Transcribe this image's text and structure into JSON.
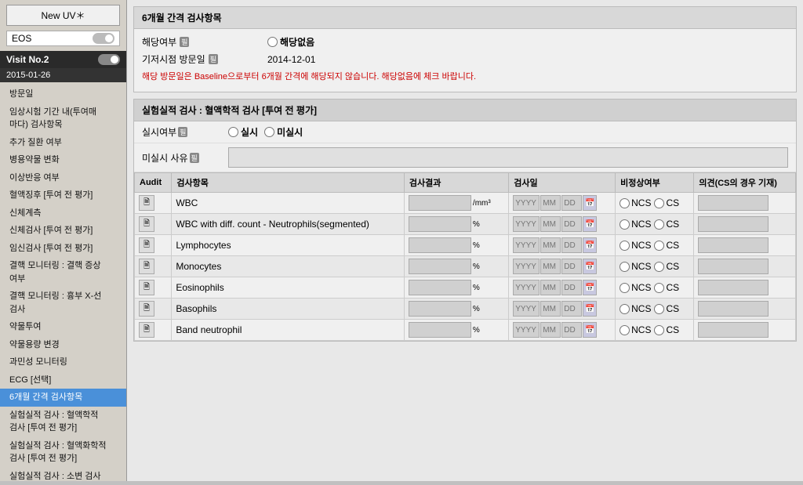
{
  "sidebar": {
    "new_uv_label": "New UV＊",
    "eos_label": "EOS",
    "visit_label": "Visit No.2",
    "visit_date": "2015-01-26",
    "nav_items": [
      {
        "id": "bangmunl",
        "label": "방문일"
      },
      {
        "id": "clinical-period",
        "label": "임상시험 기간 내(투여매마다) 검사항목"
      },
      {
        "id": "followup",
        "label": "추가 질환 여부"
      },
      {
        "id": "concomitant",
        "label": "병용약물 변화"
      },
      {
        "id": "adverse",
        "label": "이상반응 여부"
      },
      {
        "id": "hematology-pre",
        "label": "혈액징후 [투여 전 평가]"
      },
      {
        "id": "physical",
        "label": "신체계측"
      },
      {
        "id": "physical-pre",
        "label": "신체검사 [투여 전 평가]"
      },
      {
        "id": "pregnancy",
        "label": "임신검사 [투여 전 평가]"
      },
      {
        "id": "tuberculosis",
        "label": "결핵 모니터링 : 결핵 증상 여부"
      },
      {
        "id": "tuberculosis-xray",
        "label": "결핵 모니터링 : 흉부 X-선 검사"
      },
      {
        "id": "drug-admin",
        "label": "약물투여"
      },
      {
        "id": "drug-dose",
        "label": "약물용량 변경"
      },
      {
        "id": "allergy",
        "label": "과민성 모니터링"
      },
      {
        "id": "ecg",
        "label": "ECG [선택]"
      },
      {
        "id": "6month",
        "label": "6개월 간격 검사항목",
        "active": true
      },
      {
        "id": "blood-pre",
        "label": "실험실적 검사 : 혈액학적 검사 [투여 전 평가]"
      },
      {
        "id": "blood-chem-pre",
        "label": "실험실적 검사 : 혈액화학적 검사 [투여 전 평가]"
      },
      {
        "id": "urine",
        "label": "실험실적 검사 : 소변 검사"
      }
    ]
  },
  "section_6month": {
    "title": "6개월 간격 검사항목",
    "fields": {
      "applicable_label": "해당여부",
      "applicable_mark": "필",
      "applicable_no_label": "해당없음",
      "baseline_label": "기저시점 방문일",
      "baseline_mark": "필",
      "baseline_value": "2014-12-01",
      "warning_text": "해당 방문일은 Baseline으로부터 6개월 간격에 해당되지 않습니다. 해당없음에 체크 바랍니다."
    }
  },
  "section_hematology": {
    "title": "실험실적 검사 : 혈액학적 검사 [투여 전 평가]",
    "performed_label": "실시여부",
    "performed_mark": "필",
    "performed_radio_yes": "실시",
    "performed_radio_no": "미실시",
    "not_performed_label": "미실시 사유",
    "not_performed_mark": "필",
    "table": {
      "headers": [
        "Audit",
        "검사항목",
        "검사결과",
        "검사일",
        "비정상여부",
        "의견(CS의 경우 기재)"
      ],
      "rows": [
        {
          "audit": true,
          "item": "WBC",
          "result": "",
          "unit": "/mm³",
          "date_placeholder": "YYYY-MM-DD",
          "ncs": true,
          "cs": true
        },
        {
          "audit": true,
          "item": "WBC with diff. count - Neutrophils(segmented)",
          "result": "",
          "unit": "%",
          "date_placeholder": "YYYY-MM-DD",
          "ncs": true,
          "cs": true
        },
        {
          "audit": true,
          "item": "Lymphocytes",
          "result": "",
          "unit": "%",
          "date_placeholder": "YYYY-MM-DD",
          "ncs": true,
          "cs": true
        },
        {
          "audit": true,
          "item": "Monocytes",
          "result": "",
          "unit": "%",
          "date_placeholder": "YYYY-MM-DD",
          "ncs": true,
          "cs": true
        },
        {
          "audit": true,
          "item": "Eosinophils",
          "result": "",
          "unit": "%",
          "date_placeholder": "YYYY-MM-DD",
          "ncs": true,
          "cs": true
        },
        {
          "audit": true,
          "item": "Basophils",
          "result": "",
          "unit": "%",
          "date_placeholder": "YYYY-MM-DD",
          "ncs": true,
          "cs": true
        },
        {
          "audit": true,
          "item": "Band neutrophil",
          "result": "",
          "unit": "%",
          "date_placeholder": "YYYY-MM-DD",
          "ncs": true,
          "cs": true
        }
      ]
    }
  },
  "colors": {
    "header_bg": "#d8d8d8",
    "panel_bg": "#f0f0f0",
    "warning_red": "#cc0000",
    "active_nav": "#2a2a2a"
  }
}
